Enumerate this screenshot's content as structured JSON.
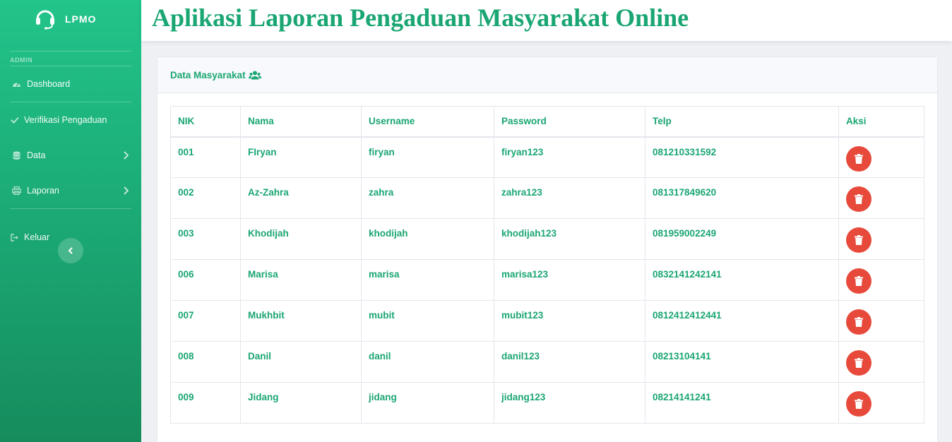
{
  "app": {
    "brand": "LPMO",
    "title": "Aplikasi Laporan Pengaduan Masyarakat Online"
  },
  "sidebar": {
    "section_heading": "ADMIN",
    "items": [
      {
        "label": "Dashboard",
        "icon": "dashboard-icon"
      },
      {
        "label": "Verifikasi Pengaduan",
        "icon": "check-icon"
      },
      {
        "label": "Data",
        "icon": "database-icon",
        "has_submenu": true
      },
      {
        "label": "Laporan",
        "icon": "print-icon",
        "has_submenu": true
      },
      {
        "label": "Keluar",
        "icon": "logout-icon"
      }
    ]
  },
  "card": {
    "title": "Data Masyarakat",
    "icon": "users-icon"
  },
  "table": {
    "columns": [
      "NIK",
      "Nama",
      "Username",
      "Password",
      "Telp",
      "Aksi"
    ],
    "rows": [
      {
        "nik": "001",
        "nama": "FIryan",
        "username": "firyan",
        "password": "firyan123",
        "telp": "081210331592"
      },
      {
        "nik": "002",
        "nama": "Az-Zahra",
        "username": "zahra",
        "password": "zahra123",
        "telp": "081317849620"
      },
      {
        "nik": "003",
        "nama": "Khodijah",
        "username": "khodijah",
        "password": "khodijah123",
        "telp": "081959002249"
      },
      {
        "nik": "006",
        "nama": "Marisa",
        "username": "marisa",
        "password": "marisa123",
        "telp": "0832141242141"
      },
      {
        "nik": "007",
        "nama": "Mukhbit",
        "username": "mubit",
        "password": "mubit123",
        "telp": "0812412412441"
      },
      {
        "nik": "008",
        "nama": "Danil",
        "username": "danil",
        "password": "danil123",
        "telp": "08213104141"
      },
      {
        "nik": "009",
        "nama": "Jidang",
        "username": "jidang",
        "password": "jidang123",
        "telp": "08214141241"
      }
    ]
  },
  "colors": {
    "accent": "#1aa672",
    "sidebar_top": "#22c48a",
    "danger": "#e74a3b"
  }
}
